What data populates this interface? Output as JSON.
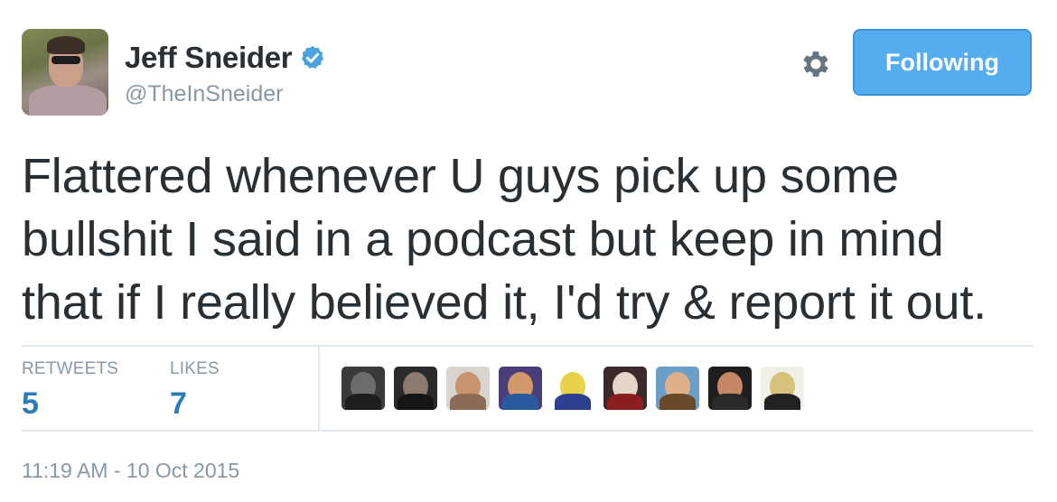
{
  "user": {
    "display_name": "Jeff Sneider",
    "handle": "@TheInSneider",
    "verified": true
  },
  "actions": {
    "follow_label": "Following",
    "settings_icon": "gear-icon"
  },
  "tweet": {
    "lines": [
      "Flattered whenever U guys pick up some",
      "bullshit I said in a podcast but keep in mind",
      "that if I really believed it, I'd try & report it out."
    ]
  },
  "stats": {
    "retweets_label": "RETWEETS",
    "retweets_value": "5",
    "likes_label": "LIKES",
    "likes_value": "7"
  },
  "likers": [
    {
      "name": "liker-avatar-1"
    },
    {
      "name": "liker-avatar-2"
    },
    {
      "name": "liker-avatar-3"
    },
    {
      "name": "liker-avatar-4"
    },
    {
      "name": "liker-avatar-5"
    },
    {
      "name": "liker-avatar-6"
    },
    {
      "name": "liker-avatar-7"
    },
    {
      "name": "liker-avatar-8"
    },
    {
      "name": "liker-avatar-9"
    }
  ],
  "timestamp": "11:19 AM - 10 Oct 2015",
  "colors": {
    "accent": "#55acee",
    "link_blue": "#2b7bb9",
    "muted": "#8899a6",
    "text": "#292f33"
  }
}
